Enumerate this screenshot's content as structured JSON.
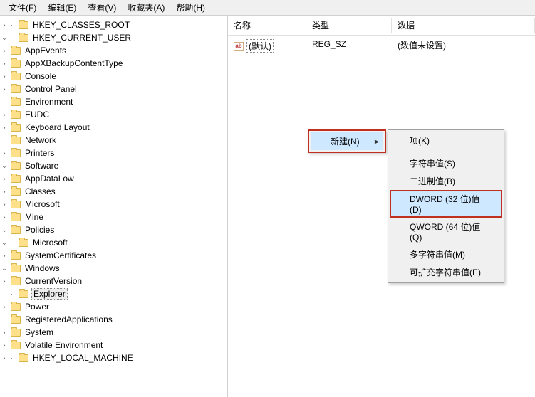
{
  "menubar": {
    "file": "文件(F)",
    "edit": "编辑(E)",
    "view": "查看(V)",
    "favorites": "收藏夹(A)",
    "help": "帮助(H)"
  },
  "list": {
    "col_name": "名称",
    "col_type": "类型",
    "col_data": "数据",
    "default_name": "(默认)",
    "default_type": "REG_SZ",
    "default_data": "(数值未设置)",
    "ab_icon": "ab"
  },
  "tree": {
    "hkcr": "HKEY_CLASSES_ROOT",
    "hkcu": "HKEY_CURRENT_USER",
    "appevents": "AppEvents",
    "appxbackup": "AppXBackupContentType",
    "console": "Console",
    "controlpanel": "Control Panel",
    "environment": "Environment",
    "eudc": "EUDC",
    "keyboard": "Keyboard Layout",
    "network": "Network",
    "printers": "Printers",
    "software": "Software",
    "appdatalow": "AppDataLow",
    "classes": "Classes",
    "microsoft": "Microsoft",
    "mine": "Mine",
    "policies": "Policies",
    "ms2": "Microsoft",
    "systemcerts": "SystemCertificates",
    "windows": "Windows",
    "currentversion": "CurrentVersion",
    "explorer": "Explorer",
    "power": "Power",
    "regapps": "RegisteredApplications",
    "system": "System",
    "volatile": "Volatile Environment",
    "hklm": "HKEY_LOCAL_MACHINE"
  },
  "ctx": {
    "new": "新建(N)",
    "key": "项(K)",
    "string": "字符串值(S)",
    "binary": "二进制值(B)",
    "dword": "DWORD (32 位)值(D)",
    "qword": "QWORD (64 位)值(Q)",
    "multi": "多字符串值(M)",
    "expand": "可扩充字符串值(E)"
  },
  "glyph": {
    "right": "›",
    "down": "⌄"
  }
}
